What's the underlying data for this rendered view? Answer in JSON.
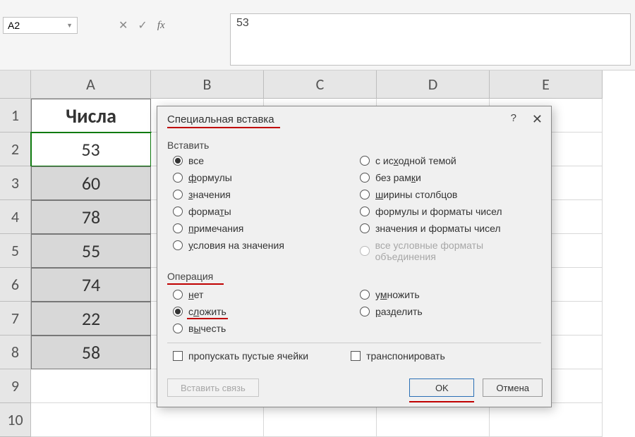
{
  "formula_bar": {
    "cell_ref": "A2",
    "value": "53",
    "fx_label": "fx"
  },
  "columns": [
    "A",
    "B",
    "C",
    "D",
    "E"
  ],
  "rows": [
    {
      "num": "1",
      "a": "Числа"
    },
    {
      "num": "2",
      "a": "53"
    },
    {
      "num": "3",
      "a": "60"
    },
    {
      "num": "4",
      "a": "78"
    },
    {
      "num": "5",
      "a": "55"
    },
    {
      "num": "6",
      "a": "74"
    },
    {
      "num": "7",
      "a": "22"
    },
    {
      "num": "8",
      "a": "58"
    },
    {
      "num": "9",
      "a": ""
    },
    {
      "num": "10",
      "a": ""
    }
  ],
  "dialog": {
    "title": "Специальная вставка",
    "sections": {
      "paste": "Вставить",
      "operation": "Операция"
    },
    "paste_options_left": [
      {
        "label": "все",
        "checked": true,
        "accel": ""
      },
      {
        "label": "формулы",
        "checked": false,
        "accel": "ф"
      },
      {
        "label": "значения",
        "checked": false,
        "accel": "з"
      },
      {
        "label": "форматы",
        "checked": false,
        "accel": "т"
      },
      {
        "label": "примечания",
        "checked": false,
        "accel": "п"
      },
      {
        "label": "условия на значения",
        "checked": false,
        "accel": "у"
      }
    ],
    "paste_options_right": [
      {
        "label": "с исходной темой",
        "checked": false,
        "accel": "х"
      },
      {
        "label": "без рамки",
        "checked": false,
        "accel": "к"
      },
      {
        "label": "ширины столбцов",
        "checked": false,
        "accel": "ш"
      },
      {
        "label": "формулы и форматы чисел",
        "checked": false,
        "accel": ""
      },
      {
        "label": "значения и форматы чисел",
        "checked": false,
        "accel": ""
      },
      {
        "label": "все условные форматы объединения",
        "checked": false,
        "disabled": true
      }
    ],
    "op_left": [
      {
        "label": "нет",
        "checked": false,
        "accel": "н"
      },
      {
        "label": "сложить",
        "checked": true,
        "accel": "л",
        "highlight": true
      },
      {
        "label": "вычесть",
        "checked": false,
        "accel": "ы"
      }
    ],
    "op_right": [
      {
        "label": "умножить",
        "checked": false,
        "accel": "м"
      },
      {
        "label": "разделить",
        "checked": false,
        "accel": "р"
      }
    ],
    "checks": {
      "skip_blanks": "пропускать пустые ячейки",
      "transpose": "транспонировать"
    },
    "buttons": {
      "paste_link": "Вставить связь",
      "ok": "OK",
      "cancel": "Отмена"
    }
  }
}
